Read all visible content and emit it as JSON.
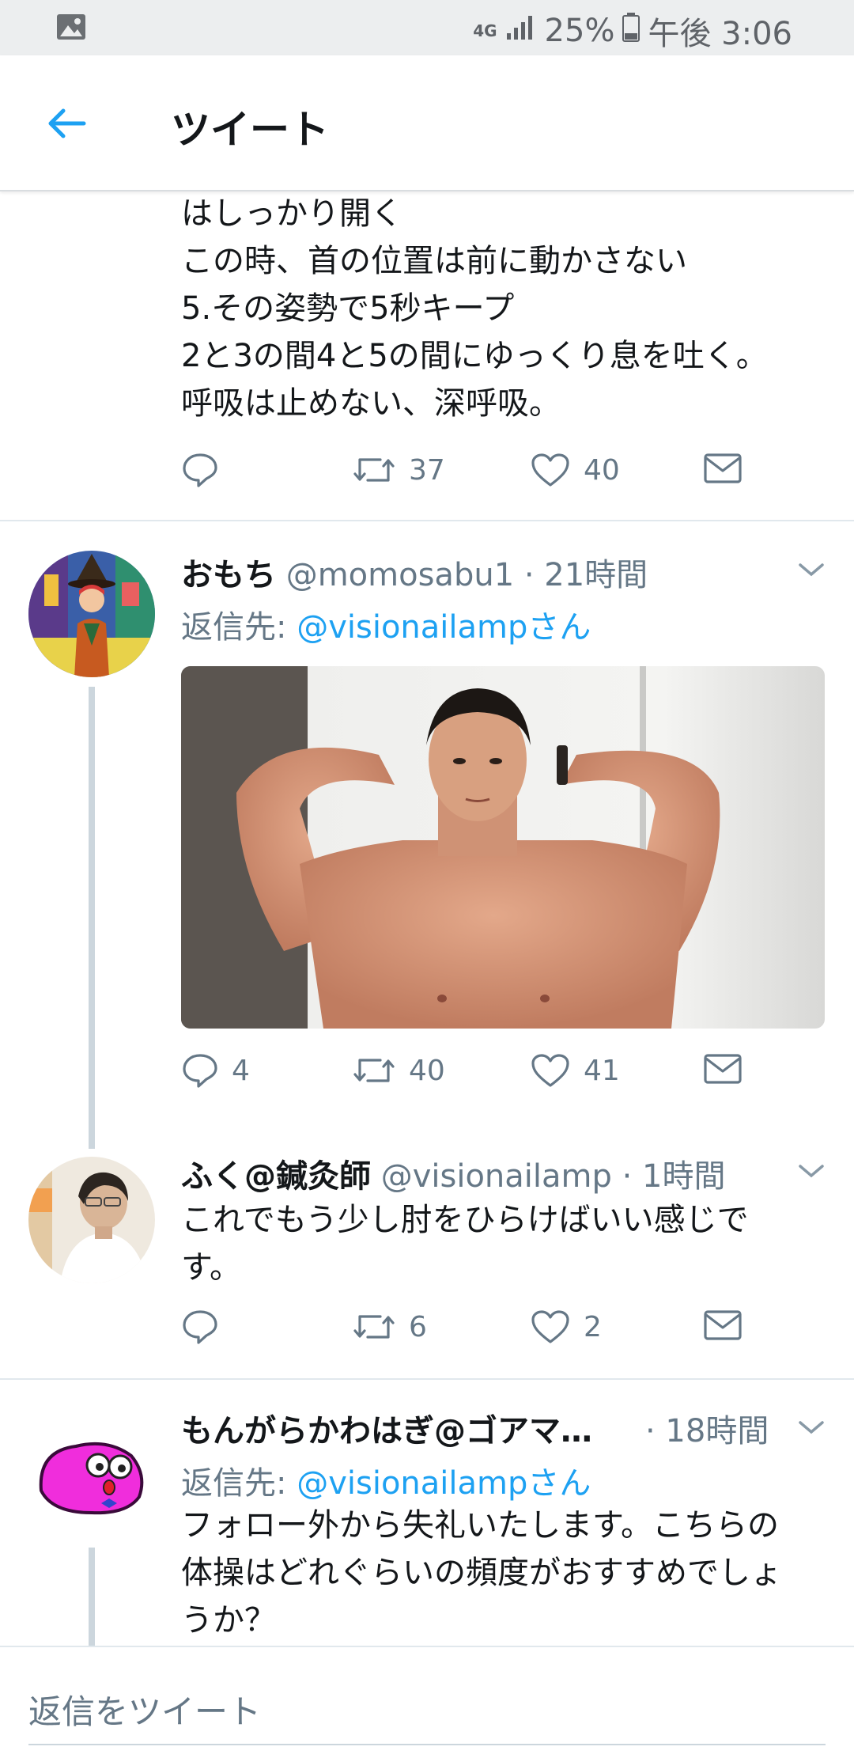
{
  "status_bar": {
    "network": "4G",
    "battery": "25%",
    "time": "午後 3:06"
  },
  "app_bar": {
    "title": "ツイート"
  },
  "tweet_top": {
    "text": "はしっかり開く\nこの時、首の位置は前に動かさない\n5.その姿勢で5秒キープ\n2と3の間4と5の間にゆっくり息を吐く。\n呼吸は止めない、深呼吸。",
    "retweets": "37",
    "likes": "40"
  },
  "tweets": [
    {
      "name": "おもち",
      "handle": "@momosabu1",
      "time": "· 21時間",
      "reply_prefix": "返信先: ",
      "reply_to": "@visionailampさん",
      "replies": "4",
      "retweets": "40",
      "likes": "41"
    },
    {
      "name": "ふく@鍼灸師",
      "handle": "@visionailamp",
      "time": "· 1時間",
      "text": "これでもう少し肘をひらけばいい感じです。",
      "replies": "",
      "retweets": "6",
      "likes": "2"
    },
    {
      "name": "もんがらかわはぎ@ゴアマ…",
      "time": "· 18時間",
      "reply_prefix": "返信先: ",
      "reply_to": "@visionailampさん",
      "text": "フォロー外から失礼いたします。こちらの体操はどれぐらいの頻度がおすすめでしょうか？"
    }
  ],
  "bottom_bar": {
    "placeholder": "返信をツイート"
  },
  "colors": {
    "accent": "#1da1f2",
    "muted": "#657786",
    "divider": "#e1e8ed"
  }
}
